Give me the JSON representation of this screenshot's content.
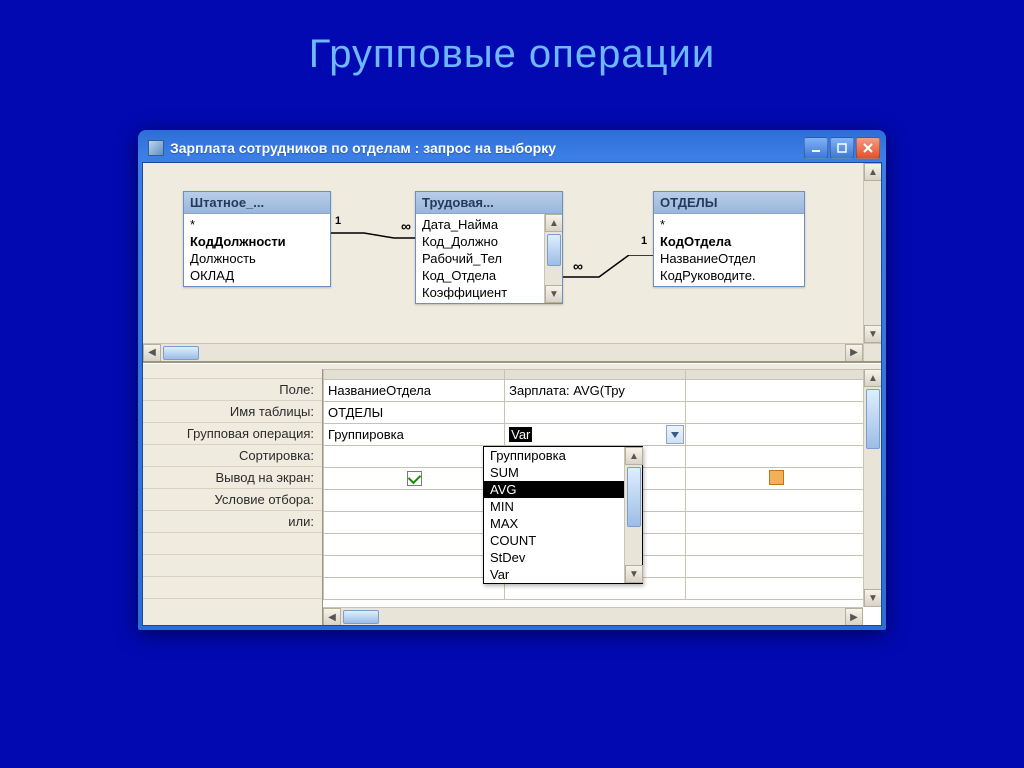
{
  "slide_title": "Групповые операции",
  "window": {
    "title": "Зарплата сотрудников по отделам : запрос на выборку"
  },
  "entities": [
    {
      "name": "Штатное_...",
      "fields": [
        "*",
        "КодДолжности",
        "Должность",
        "ОКЛАД"
      ],
      "bold": [
        1
      ],
      "scroll": false
    },
    {
      "name": "Трудовая...",
      "fields": [
        "Дата_Найма",
        "Код_Должно",
        "Рабочий_Тел",
        "Код_Отдела",
        "Коэффициент"
      ],
      "bold": [],
      "scroll": true
    },
    {
      "name": "ОТДЕЛЫ",
      "fields": [
        "*",
        "КодОтдела",
        "НазваниеОтдел",
        "КодРуководите."
      ],
      "bold": [
        1
      ],
      "scroll": false
    }
  ],
  "rel_labels": {
    "one": "1",
    "many": "∞"
  },
  "qbe_rows": [
    "Поле:",
    "Имя таблицы:",
    "Групповая операция:",
    "Сортировка:",
    "Вывод на экран:",
    "Условие отбора:",
    "или:"
  ],
  "qbe_cols": [
    {
      "field": "НазваниеОтдела",
      "table": "ОТДЕЛЫ",
      "groupop": "Группировка",
      "sort": "",
      "show": true,
      "crit": "",
      "or": ""
    },
    {
      "field": "Зарплата: AVG(Тру",
      "table": "",
      "groupop": "Var",
      "groupop_sel": true,
      "sort": "",
      "show": false,
      "crit": "",
      "or": ""
    },
    {
      "field": "",
      "table": "",
      "groupop": "",
      "sort": "",
      "show_blank": true,
      "crit": "",
      "or": ""
    }
  ],
  "dropdown": {
    "items": [
      "Группировка",
      "SUM",
      "AVG",
      "MIN",
      "MAX",
      "COUNT",
      "StDev",
      "Var"
    ],
    "selected": "AVG"
  }
}
